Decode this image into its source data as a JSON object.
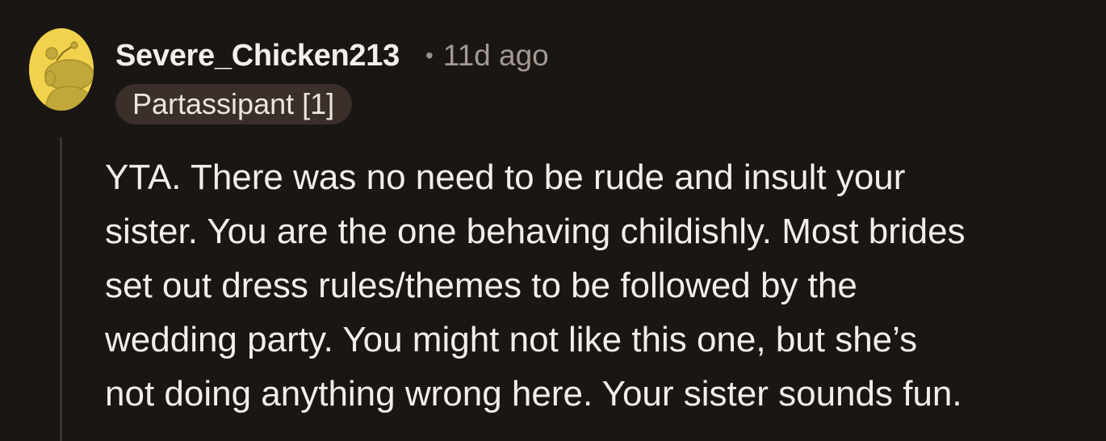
{
  "comment": {
    "username": "Severe_Chicken213",
    "separator": "•",
    "time_ago": "11d ago",
    "flair": "Partassipant [1]",
    "avatar_icon": "snoo-avatar-icon",
    "body": "YTA. There was no need to be rude and insult your\nsister. You are the one behaving childishly. Most brides\nset out dress rules/themes to be followed by the\nwedding party. You might not like this one, but she’s\nnot doing anything wrong here. Your sister sounds fun."
  },
  "colors": {
    "background": "#1a1614",
    "avatar": "#f2d24c",
    "flair_bg": "#3a2f2a",
    "muted_text": "#a39892"
  }
}
